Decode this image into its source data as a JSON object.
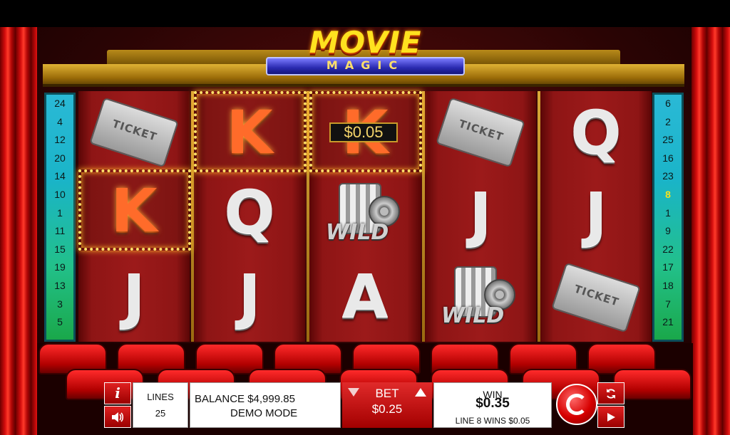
{
  "logo": {
    "title": "MOVIE",
    "subtitle": "MAGIC"
  },
  "paylines": {
    "left": [
      "24",
      "4",
      "12",
      "20",
      "14",
      "10",
      "1",
      "11",
      "15",
      "19",
      "13",
      "3",
      "5"
    ],
    "right": [
      "6",
      "2",
      "25",
      "16",
      "23",
      "8",
      "1",
      "9",
      "22",
      "17",
      "18",
      "7",
      "21"
    ],
    "active_right": "8"
  },
  "reels": {
    "r1": [
      "ticket-icon",
      "K",
      "J"
    ],
    "r2": [
      "K",
      "Q",
      "J"
    ],
    "r3": [
      "K",
      "wild-icon",
      "A"
    ],
    "r4": [
      "ticket-icon",
      "J",
      "wild-icon"
    ],
    "r5": [
      "Q",
      "J",
      "ticket-icon"
    ]
  },
  "symbols": {
    "ticket_text": "TICKET",
    "wild_text": "WILD"
  },
  "win_tag": "$0.05",
  "controls": {
    "info_icon": "i",
    "sound_icon": "sound-icon",
    "lines_label": "LINES",
    "lines_value": "25",
    "balance_text": "BALANCE $4,999.85",
    "mode_text": "DEMO MODE",
    "bet_label": "BET",
    "bet_value": "$0.25",
    "win_label": "WIN",
    "win_value": "$0.35",
    "win_detail": "LINE 8 WINS $0.05",
    "autoplay_icon": "refresh-icon",
    "play_icon": "play-icon"
  },
  "colors": {
    "accent": "#d60000",
    "marquee": "#ffe26a",
    "payline_active": "#f7e11e"
  }
}
